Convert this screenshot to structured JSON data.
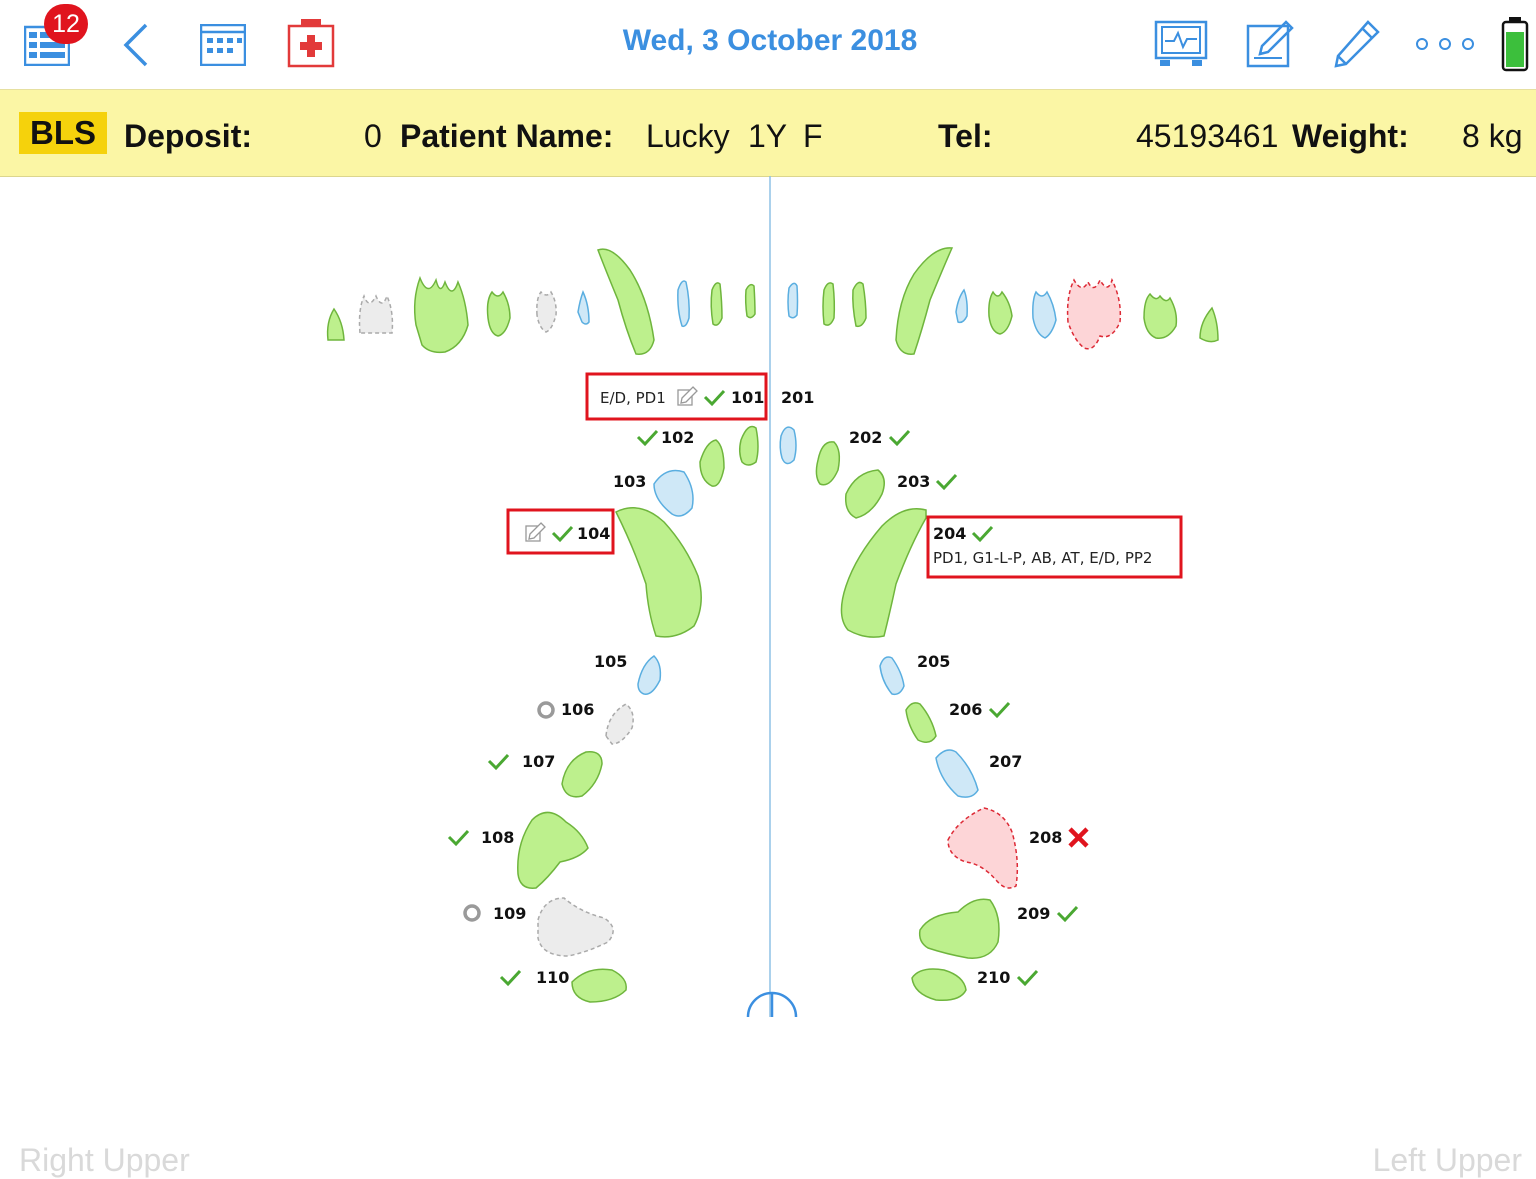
{
  "header": {
    "date": "Wed, 3 October 2018",
    "badge_count": "12",
    "icons": [
      "list-icon",
      "back-icon",
      "calendar-icon",
      "medical-kit-icon",
      "monitor-icon",
      "edit-note-icon",
      "pencil-icon",
      "more-icon",
      "battery-icon"
    ]
  },
  "patient": {
    "tag": "BLS",
    "deposit_label": "Deposit:",
    "deposit_value": "0",
    "name_label": "Patient Name:",
    "name": "Lucky",
    "age": "1Y",
    "sex": "F",
    "tel_label": "Tel:",
    "tel": "45193461",
    "weight_label": "Weight:",
    "weight": "8 kg"
  },
  "chart": {
    "left_label": "Right Upper",
    "right_label": "Left Upper",
    "colors": {
      "ok": "#bdf08d",
      "ok_stroke": "#6fb53d",
      "blue": "#cfe8f7",
      "blue_stroke": "#5aaee0",
      "missing": "#ececec",
      "missing_stroke": "#aaaaaa",
      "red": "#fdd5d7",
      "red_stroke": "#dd2a36",
      "check": "#4aa832",
      "cross": "#e0141e"
    },
    "teeth": [
      {
        "id": "101",
        "status": "check",
        "note": "E/D, PD1",
        "edit": true,
        "highlight": true
      },
      {
        "id": "102",
        "status": "check"
      },
      {
        "id": "103",
        "status": "none"
      },
      {
        "id": "104",
        "status": "check",
        "edit": true,
        "highlight": true
      },
      {
        "id": "105",
        "status": "none"
      },
      {
        "id": "106",
        "status": "circle"
      },
      {
        "id": "107",
        "status": "check"
      },
      {
        "id": "108",
        "status": "check"
      },
      {
        "id": "109",
        "status": "circle"
      },
      {
        "id": "110",
        "status": "check"
      },
      {
        "id": "201",
        "status": "none"
      },
      {
        "id": "202",
        "status": "check"
      },
      {
        "id": "203",
        "status": "check"
      },
      {
        "id": "204",
        "status": "check",
        "note": "PD1, G1-L-P, AB, AT, E/D, PP2",
        "highlight": true
      },
      {
        "id": "205",
        "status": "none"
      },
      {
        "id": "206",
        "status": "check"
      },
      {
        "id": "207",
        "status": "none"
      },
      {
        "id": "208",
        "status": "cross"
      },
      {
        "id": "209",
        "status": "check"
      },
      {
        "id": "210",
        "status": "check"
      }
    ]
  }
}
